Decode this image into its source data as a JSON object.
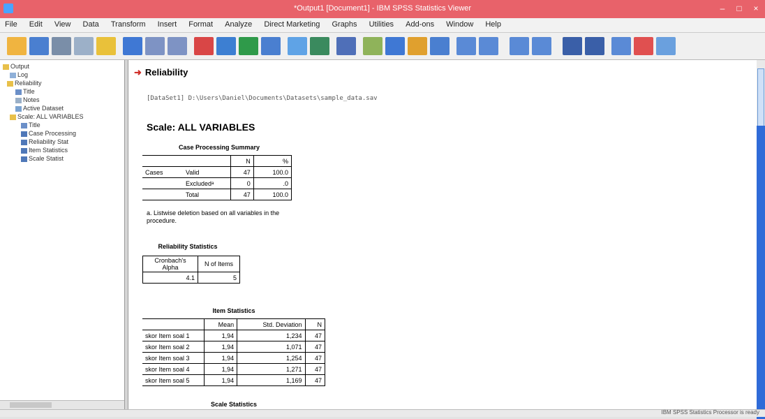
{
  "window": {
    "title": "*Output1 [Document1] - IBM SPSS Statistics Viewer",
    "buttons": [
      "‒",
      "□",
      "×"
    ]
  },
  "menu": [
    "File",
    "Edit",
    "View",
    "Data",
    "Transform",
    "Insert",
    "Format",
    "Analyze",
    "Direct Marketing",
    "Graphs",
    "Utilities",
    "Add-ons",
    "Window",
    "Help"
  ],
  "nav": {
    "items": [
      "Output",
      "Log",
      "Reliability",
      "Title",
      "Notes",
      "Active Dataset",
      "Scale: ALL VARIABLES",
      "Title",
      "Case Processing",
      "Reliability Stat",
      "Item Statistics",
      "Scale Statist"
    ]
  },
  "content": {
    "heading": "Reliability",
    "syntax": "[DataSet1] D:\\Users\\Daniel\\Documents\\Datasets\\sample_data.sav",
    "scale": "Scale: ALL VARIABLES",
    "case_summary": {
      "title": "Case Processing Summary",
      "headers": [
        "",
        "",
        "N",
        "%"
      ],
      "rows": [
        {
          "group": "Cases",
          "label": "Valid",
          "n": "47",
          "pct": "100.0"
        },
        {
          "group": "",
          "label": "Excludedᵃ",
          "n": "0",
          "pct": ".0"
        },
        {
          "group": "",
          "label": "Total",
          "n": "47",
          "pct": "100.0"
        }
      ],
      "footnote": "a. Listwise deletion based on all variables in the procedure."
    },
    "reliability": {
      "title": "Reliability Statistics",
      "headers": [
        "Cronbach's Alpha",
        "N of Items"
      ],
      "values": [
        "4.1",
        "5"
      ]
    },
    "item_stats": {
      "title": "Item Statistics",
      "headers": [
        "",
        "Mean",
        "Std. Deviation",
        "N"
      ],
      "rows": [
        [
          "skor Item soal 1",
          "1,94",
          "1,234",
          "47"
        ],
        [
          "skor Item soal 2",
          "1,94",
          "1,071",
          "47"
        ],
        [
          "skor Item soal 3",
          "1,94",
          "1,254",
          "47"
        ],
        [
          "skor Item soal 4",
          "1,94",
          "1,271",
          "47"
        ],
        [
          "skor Item soal 5",
          "1,94",
          "1,169",
          "47"
        ]
      ]
    },
    "scale_stats_title": "Scale Statistics"
  },
  "status": "IBM SPSS Statistics Processor is ready"
}
